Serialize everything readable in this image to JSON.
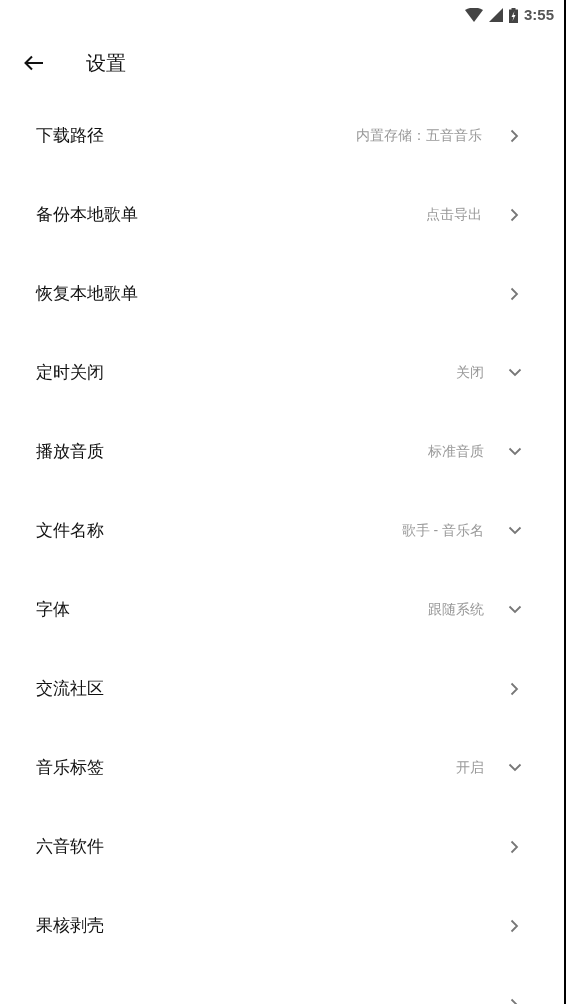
{
  "status_bar": {
    "time": "3:55"
  },
  "header": {
    "title": "设置"
  },
  "items": [
    {
      "label": "下载路径",
      "value": "内置存储：五音音乐",
      "kind": "link"
    },
    {
      "label": "备份本地歌单",
      "value": "点击导出",
      "kind": "link"
    },
    {
      "label": "恢复本地歌单",
      "kind": "link"
    },
    {
      "label": "定时关闭",
      "value": "关闭",
      "kind": "dropdown"
    },
    {
      "label": "播放音质",
      "value": "标准音质",
      "kind": "dropdown"
    },
    {
      "label": "文件名称",
      "value": "歌手 - 音乐名",
      "kind": "dropdown"
    },
    {
      "label": "字体",
      "value": "跟随系统",
      "kind": "dropdown"
    },
    {
      "label": "交流社区",
      "kind": "link"
    },
    {
      "label": "音乐标签",
      "value": "开启",
      "kind": "dropdown"
    },
    {
      "label": "六音软件",
      "kind": "link"
    },
    {
      "label": "果核剥壳",
      "kind": "link"
    },
    {
      "kind": "link"
    }
  ]
}
